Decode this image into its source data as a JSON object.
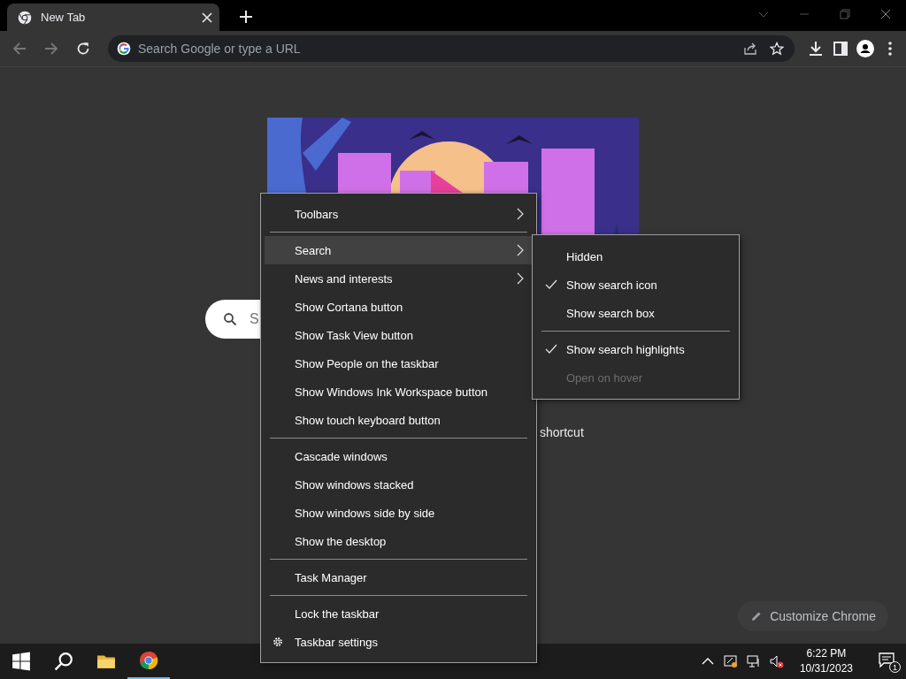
{
  "browser": {
    "tab": {
      "title": "New Tab",
      "selected": true
    },
    "address_bar": {
      "placeholder": "Search Google or type a URL"
    }
  },
  "page": {
    "search_field": {
      "placeholder": "S"
    },
    "shortcut_label": "shortcut",
    "customize_button": "Customize Chrome"
  },
  "context_menu": {
    "items": [
      {
        "kind": "item",
        "label": "Toolbars",
        "submenu": true,
        "selected": false
      },
      {
        "kind": "separator"
      },
      {
        "kind": "item",
        "label": "Search",
        "submenu": true,
        "selected": true
      },
      {
        "kind": "item",
        "label": "News and interests",
        "submenu": true,
        "selected": false
      },
      {
        "kind": "item",
        "label": "Show Cortana button",
        "submenu": false,
        "selected": false
      },
      {
        "kind": "item",
        "label": "Show Task View button",
        "submenu": false,
        "selected": false
      },
      {
        "kind": "item",
        "label": "Show People on the taskbar",
        "submenu": false,
        "selected": false
      },
      {
        "kind": "item",
        "label": "Show Windows Ink Workspace button",
        "submenu": false,
        "selected": false
      },
      {
        "kind": "item",
        "label": "Show touch keyboard button",
        "submenu": false,
        "selected": false
      },
      {
        "kind": "separator"
      },
      {
        "kind": "item",
        "label": "Cascade windows",
        "submenu": false,
        "selected": false
      },
      {
        "kind": "item",
        "label": "Show windows stacked",
        "submenu": false,
        "selected": false
      },
      {
        "kind": "item",
        "label": "Show windows side by side",
        "submenu": false,
        "selected": false
      },
      {
        "kind": "item",
        "label": "Show the desktop",
        "submenu": false,
        "selected": false
      },
      {
        "kind": "separator"
      },
      {
        "kind": "item",
        "label": "Task Manager",
        "submenu": false,
        "selected": false
      },
      {
        "kind": "separator"
      },
      {
        "kind": "item",
        "label": "Lock the taskbar",
        "submenu": false,
        "selected": false
      },
      {
        "kind": "settings",
        "label": "Taskbar settings",
        "submenu": false,
        "selected": false
      }
    ]
  },
  "search_submenu": {
    "items": [
      {
        "kind": "item",
        "label": "Hidden",
        "checked": false,
        "disabled": false
      },
      {
        "kind": "item",
        "label": "Show search icon",
        "checked": true,
        "disabled": false
      },
      {
        "kind": "item",
        "label": "Show search box",
        "checked": false,
        "disabled": false
      },
      {
        "kind": "separator"
      },
      {
        "kind": "item",
        "label": "Show search highlights",
        "checked": true,
        "disabled": false
      },
      {
        "kind": "item",
        "label": "Open on hover",
        "checked": false,
        "disabled": true
      }
    ]
  },
  "taskbar": {
    "clock": {
      "time": "6:22 PM",
      "date": "10/31/2023"
    },
    "notification_count": "1"
  }
}
